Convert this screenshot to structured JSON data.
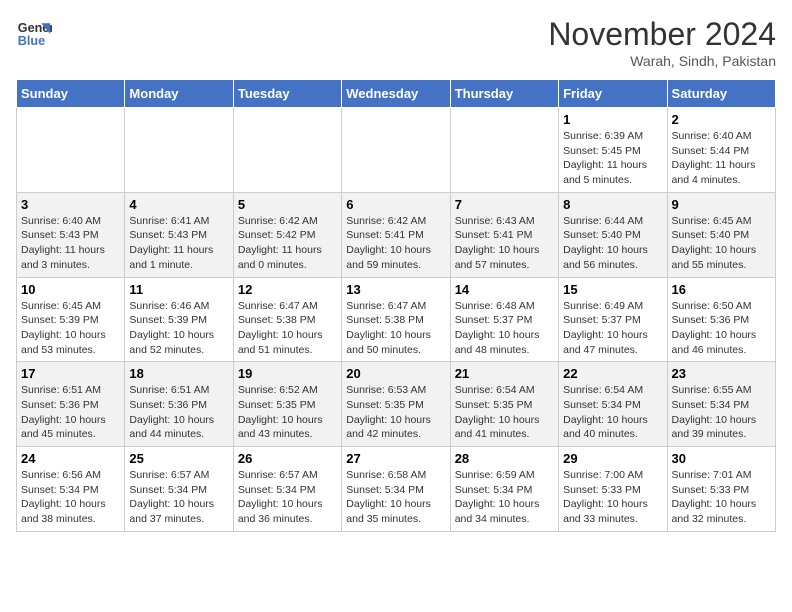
{
  "logo": {
    "line1": "General",
    "line2": "Blue"
  },
  "title": "November 2024",
  "location": "Warah, Sindh, Pakistan",
  "weekdays": [
    "Sunday",
    "Monday",
    "Tuesday",
    "Wednesday",
    "Thursday",
    "Friday",
    "Saturday"
  ],
  "weeks": [
    [
      {
        "day": "",
        "info": ""
      },
      {
        "day": "",
        "info": ""
      },
      {
        "day": "",
        "info": ""
      },
      {
        "day": "",
        "info": ""
      },
      {
        "day": "",
        "info": ""
      },
      {
        "day": "1",
        "info": "Sunrise: 6:39 AM\nSunset: 5:45 PM\nDaylight: 11 hours and 5 minutes."
      },
      {
        "day": "2",
        "info": "Sunrise: 6:40 AM\nSunset: 5:44 PM\nDaylight: 11 hours and 4 minutes."
      }
    ],
    [
      {
        "day": "3",
        "info": "Sunrise: 6:40 AM\nSunset: 5:43 PM\nDaylight: 11 hours and 3 minutes."
      },
      {
        "day": "4",
        "info": "Sunrise: 6:41 AM\nSunset: 5:43 PM\nDaylight: 11 hours and 1 minute."
      },
      {
        "day": "5",
        "info": "Sunrise: 6:42 AM\nSunset: 5:42 PM\nDaylight: 11 hours and 0 minutes."
      },
      {
        "day": "6",
        "info": "Sunrise: 6:42 AM\nSunset: 5:41 PM\nDaylight: 10 hours and 59 minutes."
      },
      {
        "day": "7",
        "info": "Sunrise: 6:43 AM\nSunset: 5:41 PM\nDaylight: 10 hours and 57 minutes."
      },
      {
        "day": "8",
        "info": "Sunrise: 6:44 AM\nSunset: 5:40 PM\nDaylight: 10 hours and 56 minutes."
      },
      {
        "day": "9",
        "info": "Sunrise: 6:45 AM\nSunset: 5:40 PM\nDaylight: 10 hours and 55 minutes."
      }
    ],
    [
      {
        "day": "10",
        "info": "Sunrise: 6:45 AM\nSunset: 5:39 PM\nDaylight: 10 hours and 53 minutes."
      },
      {
        "day": "11",
        "info": "Sunrise: 6:46 AM\nSunset: 5:39 PM\nDaylight: 10 hours and 52 minutes."
      },
      {
        "day": "12",
        "info": "Sunrise: 6:47 AM\nSunset: 5:38 PM\nDaylight: 10 hours and 51 minutes."
      },
      {
        "day": "13",
        "info": "Sunrise: 6:47 AM\nSunset: 5:38 PM\nDaylight: 10 hours and 50 minutes."
      },
      {
        "day": "14",
        "info": "Sunrise: 6:48 AM\nSunset: 5:37 PM\nDaylight: 10 hours and 48 minutes."
      },
      {
        "day": "15",
        "info": "Sunrise: 6:49 AM\nSunset: 5:37 PM\nDaylight: 10 hours and 47 minutes."
      },
      {
        "day": "16",
        "info": "Sunrise: 6:50 AM\nSunset: 5:36 PM\nDaylight: 10 hours and 46 minutes."
      }
    ],
    [
      {
        "day": "17",
        "info": "Sunrise: 6:51 AM\nSunset: 5:36 PM\nDaylight: 10 hours and 45 minutes."
      },
      {
        "day": "18",
        "info": "Sunrise: 6:51 AM\nSunset: 5:36 PM\nDaylight: 10 hours and 44 minutes."
      },
      {
        "day": "19",
        "info": "Sunrise: 6:52 AM\nSunset: 5:35 PM\nDaylight: 10 hours and 43 minutes."
      },
      {
        "day": "20",
        "info": "Sunrise: 6:53 AM\nSunset: 5:35 PM\nDaylight: 10 hours and 42 minutes."
      },
      {
        "day": "21",
        "info": "Sunrise: 6:54 AM\nSunset: 5:35 PM\nDaylight: 10 hours and 41 minutes."
      },
      {
        "day": "22",
        "info": "Sunrise: 6:54 AM\nSunset: 5:34 PM\nDaylight: 10 hours and 40 minutes."
      },
      {
        "day": "23",
        "info": "Sunrise: 6:55 AM\nSunset: 5:34 PM\nDaylight: 10 hours and 39 minutes."
      }
    ],
    [
      {
        "day": "24",
        "info": "Sunrise: 6:56 AM\nSunset: 5:34 PM\nDaylight: 10 hours and 38 minutes."
      },
      {
        "day": "25",
        "info": "Sunrise: 6:57 AM\nSunset: 5:34 PM\nDaylight: 10 hours and 37 minutes."
      },
      {
        "day": "26",
        "info": "Sunrise: 6:57 AM\nSunset: 5:34 PM\nDaylight: 10 hours and 36 minutes."
      },
      {
        "day": "27",
        "info": "Sunrise: 6:58 AM\nSunset: 5:34 PM\nDaylight: 10 hours and 35 minutes."
      },
      {
        "day": "28",
        "info": "Sunrise: 6:59 AM\nSunset: 5:34 PM\nDaylight: 10 hours and 34 minutes."
      },
      {
        "day": "29",
        "info": "Sunrise: 7:00 AM\nSunset: 5:33 PM\nDaylight: 10 hours and 33 minutes."
      },
      {
        "day": "30",
        "info": "Sunrise: 7:01 AM\nSunset: 5:33 PM\nDaylight: 10 hours and 32 minutes."
      }
    ]
  ]
}
